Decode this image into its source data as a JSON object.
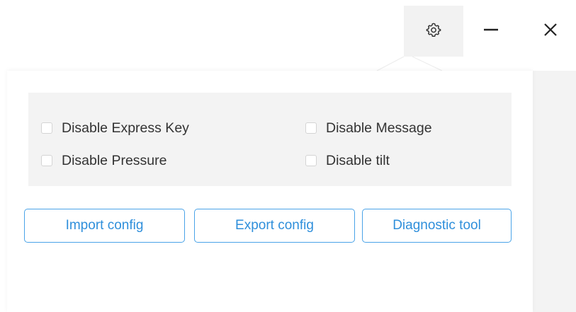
{
  "window_controls": {
    "settings_icon": "gear-icon",
    "minimize_icon": "minimize-icon",
    "close_icon": "close-icon"
  },
  "options": [
    {
      "label": "Disable Express Key",
      "checked": false
    },
    {
      "label": "Disable Message",
      "checked": false
    },
    {
      "label": "Disable Pressure",
      "checked": false
    },
    {
      "label": "Disable tilt",
      "checked": false
    }
  ],
  "actions": {
    "import_label": "Import config",
    "export_label": "Export config",
    "diagnostic_label": "Diagnostic tool"
  },
  "colors": {
    "accent": "#2f8fdb",
    "button_border": "#4aa3e8",
    "panel_gray": "#f3f3f3"
  }
}
